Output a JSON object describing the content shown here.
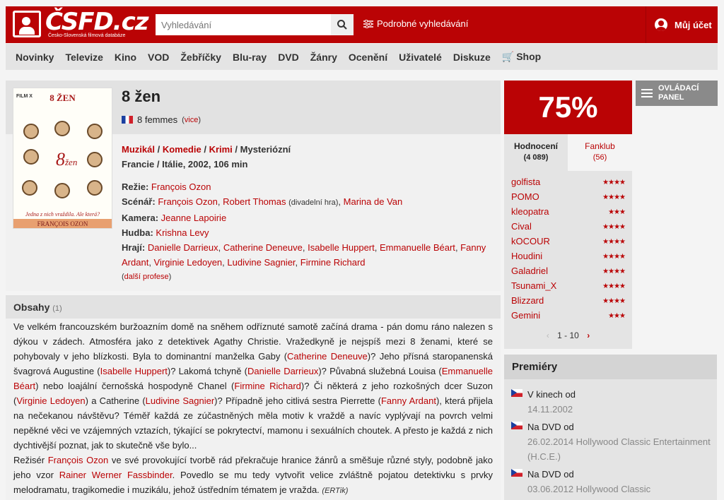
{
  "header": {
    "logo": "ČSFD.cz",
    "logo_sub": "Česko-Slovenská filmová databáze",
    "search_placeholder": "Vyhledávání",
    "advanced": "Podrobné vyhledávání",
    "account": "Můj účet"
  },
  "nav": [
    "Novinky",
    "Televize",
    "Kino",
    "VOD",
    "Žebříčky",
    "Blu-ray",
    "DVD",
    "Žánry",
    "Ocenění",
    "Uživatelé",
    "Diskuze",
    "Shop"
  ],
  "poster": {
    "label": "FILM X",
    "title": "8 ŽEN",
    "tagline": "Jedna z nich vraždila. Ale která?",
    "director": "FRANÇOIS OZON",
    "eight": "8",
    "zen": "žen"
  },
  "film": {
    "title": "8 žen",
    "orig_title": "8 femmes",
    "more": "vice",
    "genres": [
      "Muzikál",
      "Komedie",
      "Krimi",
      "Mysteriózní"
    ],
    "origin": "Francie / Itálie, 2002, 106 min",
    "rezie_label": "Režie:",
    "rezie": "François Ozon",
    "scenar_label": "Scénář:",
    "scenar1": "François Ozon",
    "scenar2": "Robert Thomas",
    "scenar2_note": "(divadelní hra)",
    "scenar3": "Marina de Van",
    "kamera_label": "Kamera:",
    "kamera": "Jeanne Lapoirie",
    "hudba_label": "Hudba:",
    "hudba": "Krishna Levy",
    "hraji_label": "Hrají:",
    "cast": [
      "Danielle Darrieux",
      "Catherine Deneuve",
      "Isabelle Huppert",
      "Emmanuelle Béart",
      "Fanny Ardant",
      "Virginie Ledoyen",
      "Ludivine Sagnier",
      "Firmine Richard"
    ],
    "more_prof": "další profese"
  },
  "plot": {
    "heading": "Obsahy",
    "count": "(1)",
    "p1": "Ve velkém francouzském buržoazním domě na sněhem odříznuté samotě začíná drama - pán domu ráno nalezen s dýkou v zádech. Atmosféra jako z detektivek Agathy Christie. Vražedkyně je nejspíš mezi 8 ženami, které se pohybovaly v jeho blízkosti. Byla to dominantní manželka Gaby (",
    "n1": "Catherine Deneuve",
    "p2": ")? Jeho přísná staropanenská švagrová Augustine (",
    "n2": "Isabelle Huppert",
    "p3": ")? Lakomá tchyně (",
    "n3": "Danielle Darrieux",
    "p4": ")? Půvabná služebná Louisa (",
    "n4": "Emmanuelle Béart",
    "p5": ") nebo loajální černošská hospodyně Chanel (",
    "n5": "Firmine Richard",
    "p6": ")? Či některá z jeho rozkošných dcer Suzon (",
    "n6": "Virginie Ledoyen",
    "p7": ") a Catherine (",
    "n7": "Ludivine Sagnier",
    "p8": ")? Případně jeho citlivá sestra Pierrette (",
    "n8": "Fanny Ardant",
    "p9": "), která přijela na nečekanou návštěvu? Téměř každá ze zúčastněných měla motiv k vraždě a navíc vyplývají na povrch velmi nepěkné věci ve vzájemných vztazích, týkající se pokrytectví, mamonu i sexuálních choutek. A přesto je každá z nich dychtivější poznat, jak to skutečně vše bylo...",
    "p10": "Režisér ",
    "n9": "François Ozon",
    "p11": " ve své provokující tvorbě rád překračuje hranice žánrů a směšuje různé styly, podobně jako jeho vzor ",
    "n10": "Rainer Werner Fassbinder",
    "p12": ". Povedlo se mu tedy vytvořit velice zvláštně pojatou detektivku s prvky melodramatu, tragikomedie i muzikálu, jehož ústředním tématem je vražda. ",
    "author": "(ERTik)"
  },
  "rating": {
    "value": "75%",
    "tab1": "Hodnocení",
    "tab1_count": "(4 089)",
    "tab2": "Fanklub",
    "tab2_count": "(56)",
    "pager": "1 - 10",
    "users": [
      {
        "name": "golfista",
        "stars": 4
      },
      {
        "name": "POMO",
        "stars": 4
      },
      {
        "name": "kleopatra",
        "stars": 3
      },
      {
        "name": "Cival",
        "stars": 4
      },
      {
        "name": "kOCOUR",
        "stars": 4
      },
      {
        "name": "Houdini",
        "stars": 4
      },
      {
        "name": "Galadriel",
        "stars": 4
      },
      {
        "name": "Tsunami_X",
        "stars": 4
      },
      {
        "name": "Blizzard",
        "stars": 4
      },
      {
        "name": "Gemini",
        "stars": 3
      }
    ]
  },
  "panel": {
    "label": "OVLÁDACÍ PANEL"
  },
  "premiery": {
    "heading": "Premiéry",
    "items": [
      {
        "type": "V kinech od",
        "date": "14.11.2002"
      },
      {
        "type": "Na DVD od",
        "date": "26.02.2014 Hollywood Classic Entertainment (H.C.E.)"
      },
      {
        "type": "Na DVD od",
        "date": "03.06.2012 Hollywood Classic"
      }
    ]
  }
}
